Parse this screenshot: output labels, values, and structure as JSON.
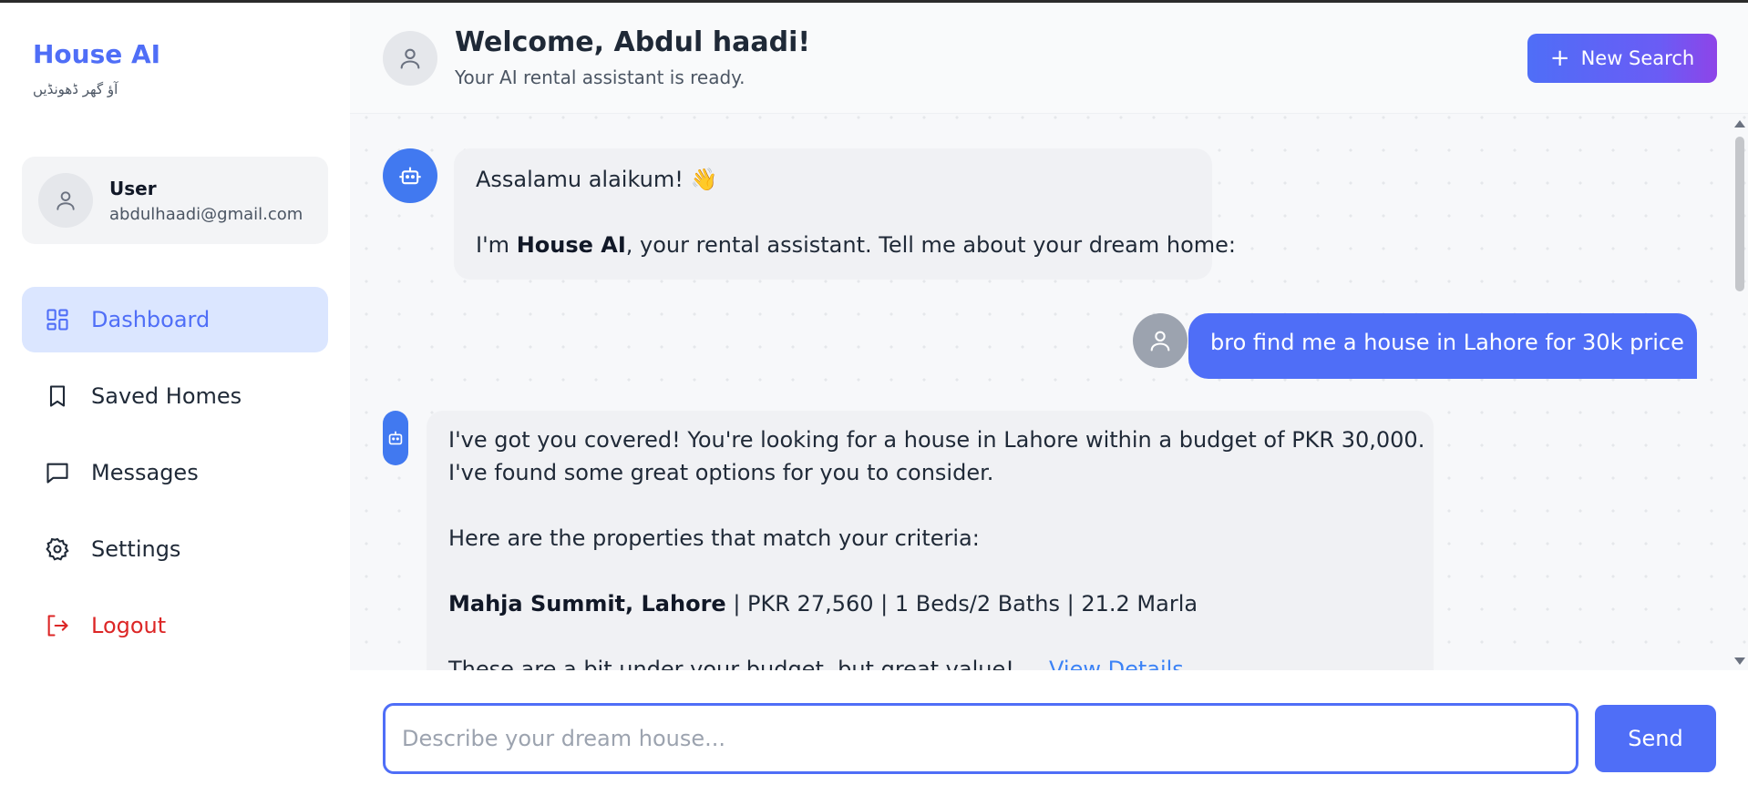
{
  "app": {
    "name": "House AI",
    "tagline": "آؤ گھر ڈھونڈیں"
  },
  "user": {
    "name": "User",
    "email": "abdulhaadi@gmail.com"
  },
  "sidebar": {
    "items": [
      {
        "label": "Dashboard",
        "icon": "dashboard-icon",
        "active": true
      },
      {
        "label": "Saved Homes",
        "icon": "bookmark-icon",
        "active": false
      },
      {
        "label": "Messages",
        "icon": "message-icon",
        "active": false
      },
      {
        "label": "Settings",
        "icon": "gear-icon",
        "active": false
      },
      {
        "label": "Logout",
        "icon": "logout-icon",
        "active": false
      }
    ]
  },
  "header": {
    "title": "Welcome, Abdul haadi!",
    "subtitle": "Your AI rental assistant is ready.",
    "new_search_label": "New Search"
  },
  "chat": {
    "messages": [
      {
        "role": "bot",
        "greeting": "Assalamu alaikum! 👋",
        "intro_prefix": "I'm ",
        "intro_bold": "House AI",
        "intro_suffix": ", your rental assistant. Tell me about your dream home:"
      },
      {
        "role": "user",
        "text": "bro find me a house in Lahore for 30k price"
      },
      {
        "role": "bot",
        "line1": "I've got you covered! You're looking for a house in Lahore within a budget of PKR 30,000.",
        "line2": "I've found some great options for you to consider.",
        "line3": "Here are the properties that match your criteria:",
        "property_name": "Mahja Summit, Lahore",
        "property_details": " | PKR 27,560 | 1 Beds/2 Baths | 21.2 Marla",
        "note": "These are a bit under your budget, but great value!",
        "link": "View Details"
      }
    ]
  },
  "composer": {
    "placeholder": "Describe your dream house...",
    "value": "",
    "send_label": "Send"
  },
  "colors": {
    "brand": "#4f6ef7",
    "bot_avatar": "#4179f0",
    "active_nav_bg": "#dbe6ff",
    "logout": "#dc2626"
  }
}
